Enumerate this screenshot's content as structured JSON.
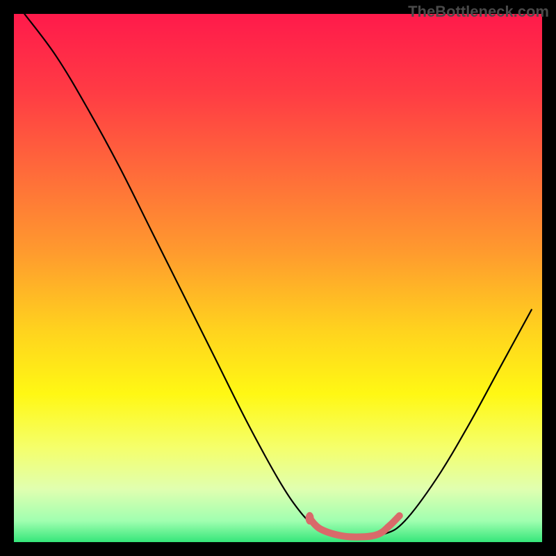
{
  "watermark": "TheBottleneck.com",
  "chart_data": {
    "type": "line",
    "title": "",
    "xlabel": "",
    "ylabel": "",
    "xlim": [
      0,
      100
    ],
    "ylim": [
      0,
      100
    ],
    "background_gradient": {
      "stops": [
        {
          "offset": 0.0,
          "color": "#FF1A4B"
        },
        {
          "offset": 0.15,
          "color": "#FF3C44"
        },
        {
          "offset": 0.3,
          "color": "#FF6B3A"
        },
        {
          "offset": 0.45,
          "color": "#FF9A2E"
        },
        {
          "offset": 0.6,
          "color": "#FFD31E"
        },
        {
          "offset": 0.72,
          "color": "#FFF814"
        },
        {
          "offset": 0.82,
          "color": "#F5FF6A"
        },
        {
          "offset": 0.9,
          "color": "#E0FFB0"
        },
        {
          "offset": 0.96,
          "color": "#A0FFB0"
        },
        {
          "offset": 1.0,
          "color": "#35E67A"
        }
      ]
    },
    "series": [
      {
        "name": "bottleneck-curve",
        "type": "line",
        "color": "#000000",
        "width": 2.2,
        "points": [
          {
            "x": 2,
            "y": 100
          },
          {
            "x": 8,
            "y": 92
          },
          {
            "x": 14,
            "y": 82
          },
          {
            "x": 20,
            "y": 71
          },
          {
            "x": 26,
            "y": 59
          },
          {
            "x": 32,
            "y": 47
          },
          {
            "x": 38,
            "y": 35
          },
          {
            "x": 44,
            "y": 23
          },
          {
            "x": 50,
            "y": 12
          },
          {
            "x": 54,
            "y": 6
          },
          {
            "x": 57,
            "y": 3
          },
          {
            "x": 60,
            "y": 1.5
          },
          {
            "x": 65,
            "y": 1
          },
          {
            "x": 70,
            "y": 1.5
          },
          {
            "x": 74,
            "y": 4
          },
          {
            "x": 80,
            "y": 12
          },
          {
            "x": 86,
            "y": 22
          },
          {
            "x": 92,
            "y": 33
          },
          {
            "x": 98,
            "y": 44
          }
        ]
      },
      {
        "name": "highlight-segment",
        "type": "line",
        "color": "#D96A6A",
        "width": 10,
        "points": [
          {
            "x": 56,
            "y": 4.5
          },
          {
            "x": 58,
            "y": 2.5
          },
          {
            "x": 62,
            "y": 1.2
          },
          {
            "x": 66,
            "y": 1
          },
          {
            "x": 69,
            "y": 1.5
          },
          {
            "x": 71,
            "y": 3
          },
          {
            "x": 73,
            "y": 5
          }
        ]
      },
      {
        "name": "highlight-dot",
        "type": "scatter",
        "color": "#D96A6A",
        "points": [
          {
            "x": 56,
            "y": 4.5
          }
        ]
      }
    ]
  }
}
